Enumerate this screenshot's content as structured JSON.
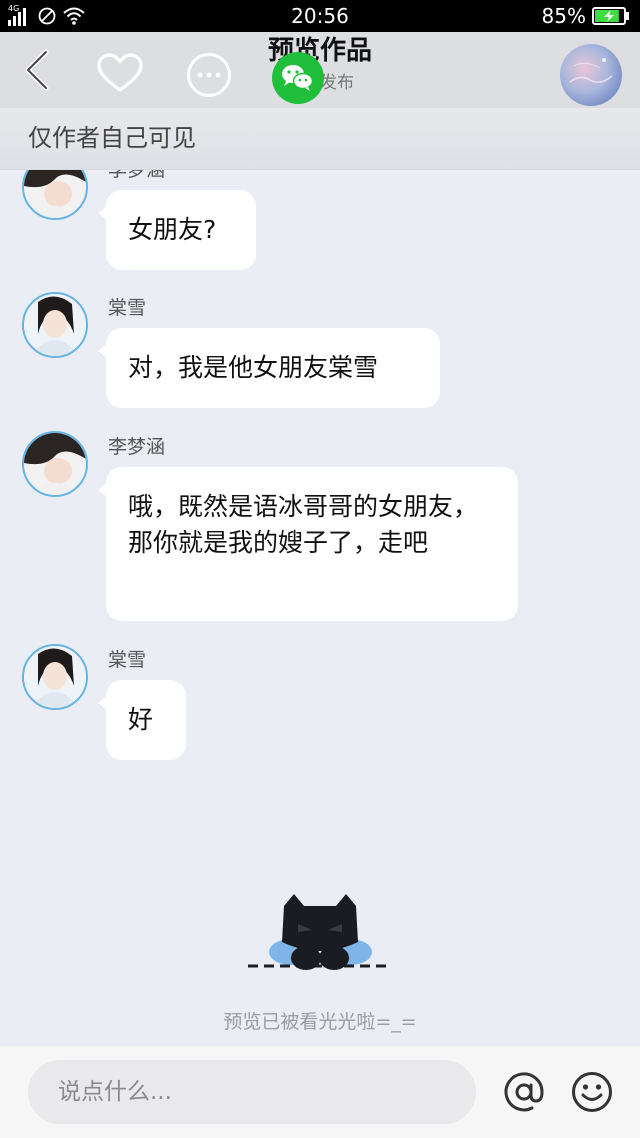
{
  "status_bar": {
    "network": "4G",
    "time": "20:56",
    "battery_percent": "85%",
    "battery_level": 0.85,
    "icons": [
      "signal-icon",
      "no-sim-icon",
      "wifi-icon",
      "battery-charging-icon"
    ]
  },
  "header": {
    "title": "预览作品",
    "subtitle": "发布",
    "icons": [
      "back-icon",
      "heart-icon",
      "more-icon",
      "wechat-icon",
      "user-avatar"
    ]
  },
  "visibility_notice": "仅作者自己可见",
  "messages": [
    {
      "sender": "李梦涵",
      "text": "女朋友?"
    },
    {
      "sender": "棠雪",
      "text": "对，我是他女朋友棠雪"
    },
    {
      "sender": "李梦涵",
      "text": "哦，既然是语冰哥哥的女朋友，那你就是我的嫂子了，走吧"
    },
    {
      "sender": "棠雪",
      "text": "好"
    }
  ],
  "footer_note": "预览已被看光光啦=_=",
  "input": {
    "placeholder": "说点什么...",
    "value": ""
  },
  "colors": {
    "accent_blue": "#66b4e3",
    "wechat_green": "#1fbf3c",
    "chat_background": "#eaedf4",
    "battery_green": "#3fdc3f"
  }
}
